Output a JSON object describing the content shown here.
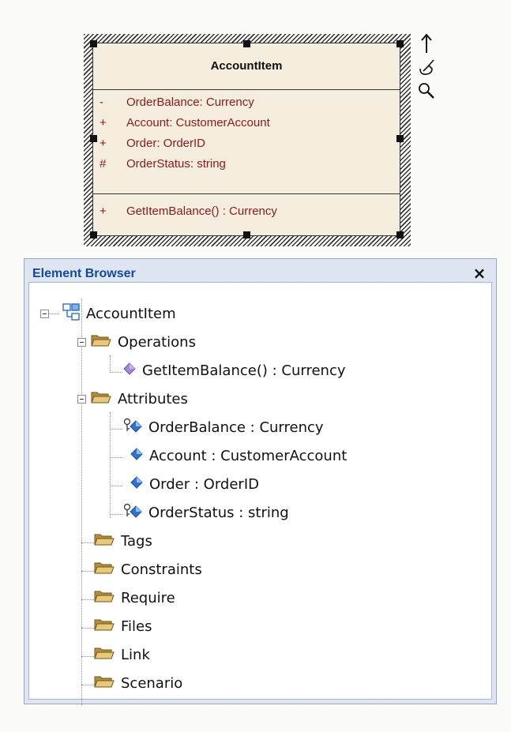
{
  "class_element": {
    "name": "AccountItem",
    "attributes": [
      {
        "visibility": "-",
        "text": "OrderBalance:  Currency"
      },
      {
        "visibility": "+",
        "text": "Account:  CustomerAccount"
      },
      {
        "visibility": "+",
        "text": "Order:  OrderID"
      },
      {
        "visibility": "#",
        "text": "OrderStatus:  string"
      }
    ],
    "operations": [
      {
        "visibility": "+",
        "text": "GetItemBalance() : Currency"
      }
    ],
    "toolbar_icons": [
      "arrow-up-icon",
      "paint-brush-icon",
      "magnifier-icon"
    ]
  },
  "browser": {
    "title": "Element Browser",
    "close_glyph": "×",
    "root": "AccountItem",
    "operations_folder": "Operations",
    "operations": [
      "GetItemBalance() : Currency"
    ],
    "attributes_folder": "Attributes",
    "attributes": [
      {
        "label": "OrderBalance : Currency",
        "icon": "key-attribute-icon"
      },
      {
        "label": "Account : CustomerAccount",
        "icon": "attribute-icon"
      },
      {
        "label": "Order : OrderID",
        "icon": "attribute-icon"
      },
      {
        "label": "OrderStatus : string",
        "icon": "key-attribute-icon"
      }
    ],
    "folders": [
      "Tags",
      "Constraints",
      "Require",
      "Files",
      "Link",
      "Scenario"
    ]
  },
  "colors": {
    "uml_fill": "#f5eedf",
    "uml_text": "#8b1a1a",
    "browser_title": "#13499b",
    "browser_bg": "#dde6f2"
  }
}
